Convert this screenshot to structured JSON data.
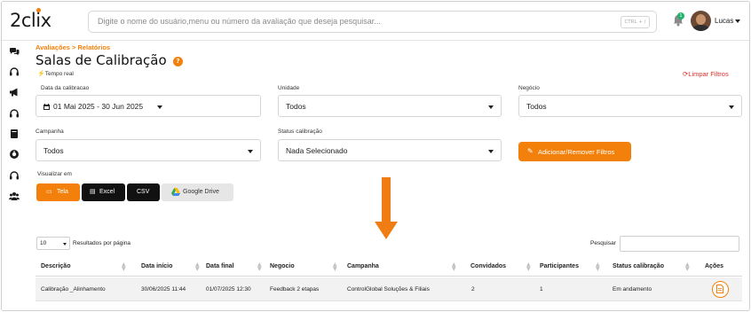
{
  "header": {
    "logo": "2clix",
    "search_placeholder": "Digite o nome do usuário,menu ou número da avaliação que deseja pesquisar...",
    "shortcut": "CTRL + /",
    "notification_count": "1",
    "user_name": "Lucas"
  },
  "sidebar": {
    "items": [
      "chat-icon",
      "headset-icon",
      "megaphone-icon",
      "headset-icon",
      "book-icon",
      "gauge-icon",
      "headset-icon",
      "users-icon"
    ]
  },
  "page": {
    "breadcrumb": "Avaliações  >  Relatórios",
    "title": "Salas de Calibração",
    "help": "?",
    "realtime": "Tempo real",
    "clear_filters": "Limpar Filtros"
  },
  "filters": {
    "date_label": "Data da calibracao",
    "date_value": "01 Mai 2025 - 30 Jun 2025",
    "unit_label": "Unidade",
    "unit_value": "Todos",
    "business_label": "Negócio",
    "business_value": "Todos",
    "campaign_label": "Campanha",
    "campaign_value": "Todos",
    "status_label": "Status calibração",
    "status_value": "Nada Selecionado",
    "add_remove_label": "Adicionar/Remover Filtros"
  },
  "view": {
    "label": "Visualizar em",
    "buttons": [
      "Tela",
      "Excel",
      "CSV",
      "Google Drive"
    ],
    "accent": "#f2800a",
    "dark": "#111111"
  },
  "table_controls": {
    "per_page_value": "10",
    "per_page_text": "Resultados por página",
    "search_label": "Pesquisar"
  },
  "table": {
    "columns": [
      "Descrição",
      "Data início",
      "Data final",
      "Negocio",
      "Campanha",
      "Convidados",
      "Participantes",
      "Status calibração",
      "Ações"
    ],
    "rows": [
      [
        "Calibração _Alinhamento",
        "30/06/2025 11:44",
        "01/07/2025 12:30",
        "Feedback 2 etapas",
        "ControlGlobal Soluções & Filiais",
        "2",
        "1",
        "Em andamento"
      ]
    ]
  }
}
